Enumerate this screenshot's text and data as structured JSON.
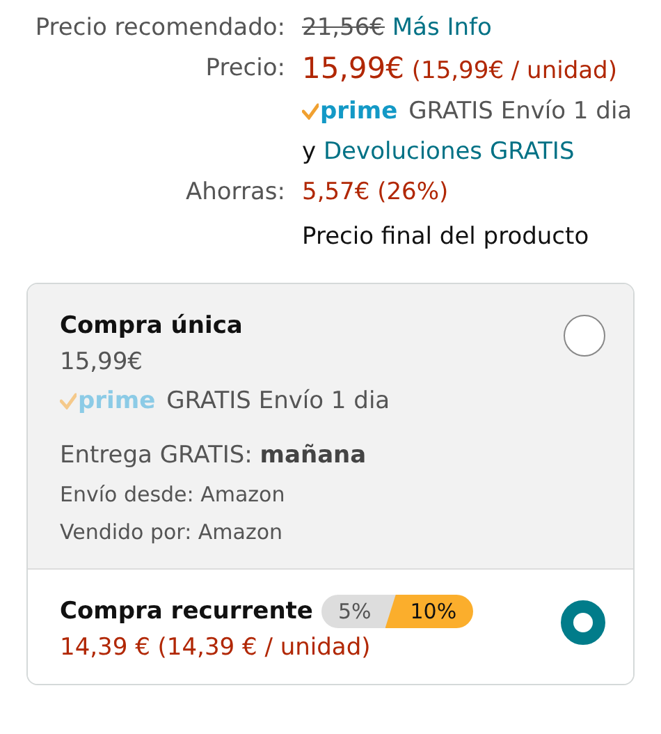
{
  "price_rows": [
    {
      "kind": "list_price",
      "label": "Precio recomendado:",
      "strike": "21,56€",
      "link": "Más Info"
    },
    {
      "kind": "price",
      "label": "Precio:",
      "price": "15,99€",
      "unit": "(15,99€ / unidad)",
      "prime": "prime",
      "shipping": "GRATIS Envío 1 dia",
      "returns_prefix": "y",
      "returns_link": "Devoluciones GRATIS"
    },
    {
      "kind": "savings",
      "label": "Ahorras:",
      "value": "5,57€ (26%)",
      "note": "Precio final del producto"
    }
  ],
  "options": [
    {
      "kind": "single",
      "selected": false,
      "title": "Compra única",
      "price": "15,99€",
      "prime": "prime",
      "shipping": "GRATIS Envío 1 dia",
      "delivery": "Entrega GRATIS: **mañana**",
      "ships_from": "Envío desde: Amazon",
      "sold_by": "Vendido por: Amazon"
    },
    {
      "kind": "recurring",
      "selected": true,
      "title": "Compra recurrente",
      "discounts": [
        {
          "label": "5%",
          "selected": false
        },
        {
          "label": "10%",
          "selected": true
        }
      ],
      "price": "14,39 € (14,39 € / unidad)"
    }
  ]
}
